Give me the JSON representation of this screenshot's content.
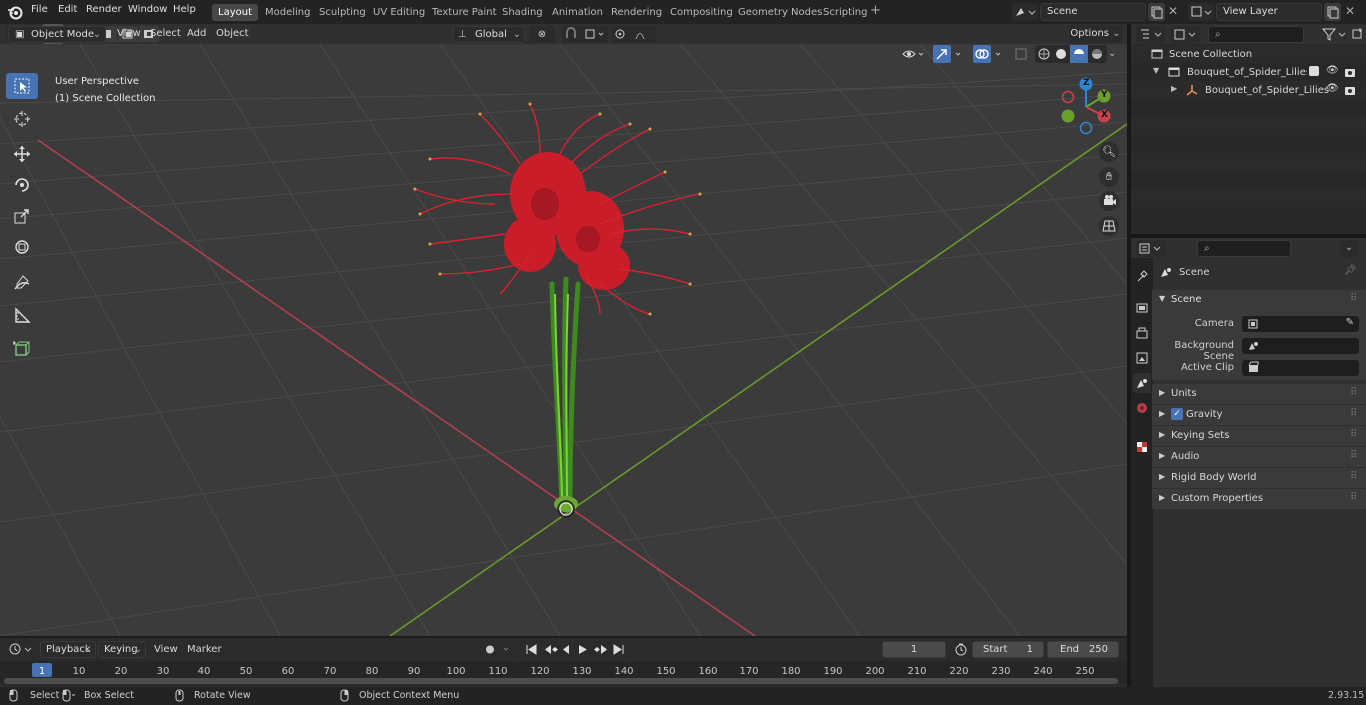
{
  "top_menu": {
    "file": "File",
    "edit": "Edit",
    "render": "Render",
    "window": "Window",
    "help": "Help"
  },
  "workspaces": [
    "Layout",
    "Modeling",
    "Sculpting",
    "UV Editing",
    "Texture Paint",
    "Shading",
    "Animation",
    "Rendering",
    "Compositing",
    "Geometry Nodes",
    "Scripting"
  ],
  "scene_name": "Scene",
  "view_layer": "View Layer",
  "viewport_header": {
    "mode": "Object Mode",
    "view": "View",
    "select": "Select",
    "add": "Add",
    "object": "Object",
    "transform": "Global",
    "options": "Options"
  },
  "viewport": {
    "perspective": "User Perspective",
    "collection": "(1) Scene Collection"
  },
  "gizmo": {
    "z": "Z",
    "y": "Y",
    "x": "X"
  },
  "outliner": {
    "root": "Scene Collection",
    "collection": "Bouquet_of_Spider_Lilies_in_(",
    "object": "Bouquet_of_Spider_Lilies"
  },
  "properties": {
    "header": "Scene",
    "panel": "Scene",
    "camera_label": "Camera",
    "background_label": "Background Scene",
    "clip_label": "Active Clip",
    "sections": [
      "Units",
      "Gravity",
      "Keying Sets",
      "Audio",
      "Rigid Body World",
      "Custom Properties"
    ]
  },
  "timeline": {
    "playback": "Playback",
    "keying": "Keying",
    "view": "View",
    "marker": "Marker",
    "current_frame": "1",
    "start_label": "Start",
    "start": "1",
    "end_label": "End",
    "end": "250"
  },
  "ruler": [
    "1",
    "10",
    "20",
    "30",
    "40",
    "50",
    "60",
    "70",
    "80",
    "90",
    "100",
    "110",
    "120",
    "130",
    "140",
    "150",
    "160",
    "170",
    "180",
    "190",
    "200",
    "210",
    "220",
    "230",
    "240",
    "250"
  ],
  "status": {
    "select": "Select",
    "box_select": "Box Select",
    "rotate": "Rotate View",
    "context": "Object Context Menu",
    "version": "2.93.15"
  },
  "colors": {
    "accent": "#4772b3",
    "x_axis": "#c9434c",
    "y_axis": "#6b9f2c",
    "z_axis": "#2f86d6"
  }
}
